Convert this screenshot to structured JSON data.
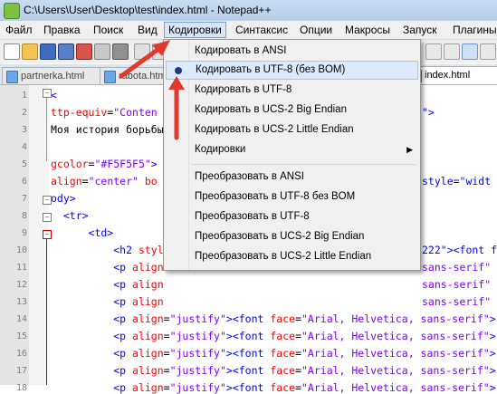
{
  "window": {
    "title": "C:\\Users\\User\\Desktop\\test\\index.html - Notepad++"
  },
  "menubar": {
    "items": [
      "Файл",
      "Правка",
      "Поиск",
      "Вид",
      "Кодировки",
      "Синтаксис",
      "Опции",
      "Макросы",
      "Запуск",
      "Плагины"
    ]
  },
  "tabs": [
    {
      "label": "partnerka.html"
    },
    {
      "label": "rabota.htm"
    },
    {
      "label": "index.html"
    }
  ],
  "editor": {
    "line_numbers": [
      "1",
      "2",
      "3",
      "4",
      "5",
      "6",
      "7",
      "8",
      "9",
      "10",
      "11",
      "12",
      "13",
      "14",
      "15",
      "16",
      "17",
      "18"
    ],
    "lines": [
      [
        {
          "c": "tag",
          "t": "<"
        }
      ],
      [
        {
          "c": "attr",
          "t": "ttp-equiv"
        },
        {
          "c": "txt",
          "t": "="
        },
        {
          "c": "val",
          "t": "\"Conten"
        }
      ],
      [
        {
          "c": "txt",
          "t": "Моя история борьбы"
        }
      ],
      [
        {
          "c": "txt",
          "t": ""
        }
      ],
      [
        {
          "c": "attr",
          "t": "gcolor"
        },
        {
          "c": "txt",
          "t": "="
        },
        {
          "c": "val",
          "t": "\"#F5F5F5\""
        },
        {
          "c": "tag",
          "t": ">"
        }
      ],
      [
        {
          "c": "attr",
          "t": "align"
        },
        {
          "c": "txt",
          "t": "="
        },
        {
          "c": "val",
          "t": "\"center\""
        },
        {
          "c": "attr",
          "t": " bo"
        }
      ],
      [
        {
          "c": "tag",
          "t": "ody>"
        }
      ],
      [
        {
          "c": "tag",
          "t": "  <tr>"
        }
      ],
      [
        {
          "c": "tag",
          "t": "      <td>"
        }
      ],
      [
        {
          "c": "tag",
          "t": "          <h2 "
        },
        {
          "c": "attr",
          "t": "styl"
        }
      ],
      [
        {
          "c": "tag",
          "t": "          <p "
        },
        {
          "c": "attr",
          "t": "align"
        }
      ],
      [
        {
          "c": "tag",
          "t": "          <p "
        },
        {
          "c": "attr",
          "t": "align"
        }
      ],
      [
        {
          "c": "tag",
          "t": "          <p "
        },
        {
          "c": "attr",
          "t": "align"
        }
      ],
      [
        {
          "c": "tag",
          "t": "          <p "
        },
        {
          "c": "attr",
          "t": "align"
        },
        {
          "c": "txt",
          "t": "="
        },
        {
          "c": "val",
          "t": "\"justify\""
        },
        {
          "c": "tag",
          "t": "><font "
        },
        {
          "c": "attr",
          "t": "face"
        },
        {
          "c": "txt",
          "t": "="
        },
        {
          "c": "val",
          "t": "\"Arial, Helvetica, sans-serif\""
        },
        {
          "c": "tag",
          "t": ">"
        }
      ],
      [
        {
          "c": "tag",
          "t": "          <p "
        },
        {
          "c": "attr",
          "t": "align"
        },
        {
          "c": "txt",
          "t": "="
        },
        {
          "c": "val",
          "t": "\"justify\""
        },
        {
          "c": "tag",
          "t": "><font "
        },
        {
          "c": "attr",
          "t": "face"
        },
        {
          "c": "txt",
          "t": "="
        },
        {
          "c": "val",
          "t": "\"Arial, Helvetica, sans-serif\""
        },
        {
          "c": "tag",
          "t": ">"
        }
      ],
      [
        {
          "c": "tag",
          "t": "          <p "
        },
        {
          "c": "attr",
          "t": "align"
        },
        {
          "c": "txt",
          "t": "="
        },
        {
          "c": "val",
          "t": "\"justify\""
        },
        {
          "c": "tag",
          "t": "><font "
        },
        {
          "c": "attr",
          "t": "face"
        },
        {
          "c": "txt",
          "t": "="
        },
        {
          "c": "val",
          "t": "\"Arial, Helvetica, sans-serif\""
        },
        {
          "c": "tag",
          "t": ">"
        }
      ],
      [
        {
          "c": "tag",
          "t": "          <p "
        },
        {
          "c": "attr",
          "t": "align"
        },
        {
          "c": "txt",
          "t": "="
        },
        {
          "c": "val",
          "t": "\"justify\""
        },
        {
          "c": "tag",
          "t": "><font "
        },
        {
          "c": "attr",
          "t": "face"
        },
        {
          "c": "txt",
          "t": "="
        },
        {
          "c": "val",
          "t": "\"Arial, Helvetica, sans-serif\""
        },
        {
          "c": "tag",
          "t": ">"
        }
      ],
      [
        {
          "c": "tag",
          "t": "          <p "
        },
        {
          "c": "attr",
          "t": "align"
        },
        {
          "c": "txt",
          "t": "="
        },
        {
          "c": "val",
          "t": "\"justify\""
        },
        {
          "c": "tag",
          "t": "><font "
        },
        {
          "c": "attr",
          "t": "face"
        },
        {
          "c": "txt",
          "t": "="
        },
        {
          "c": "val",
          "t": "\"Arial, Helvetica, sans-serif\""
        },
        {
          "c": "tag",
          "t": ">"
        }
      ]
    ],
    "right_fragments": [
      {
        "line": 2,
        "t": "\">"
      },
      {
        "line": 6,
        "t": "style=\"widt"
      },
      {
        "line": 10,
        "t": "222\"><font f"
      },
      {
        "line": 11,
        "t": "sans-serif\""
      },
      {
        "line": 12,
        "t": "sans-serif\""
      },
      {
        "line": 13,
        "t": "sans-serif\""
      }
    ]
  },
  "encoding_menu": {
    "items": [
      {
        "label": "Кодировать в ANSI",
        "checked": false,
        "highlighted": false,
        "submenu": false
      },
      {
        "label": "Кодировать в UTF-8 (без BOM)",
        "checked": true,
        "highlighted": true,
        "submenu": false
      },
      {
        "label": "Кодировать в UTF-8",
        "checked": false,
        "highlighted": false,
        "submenu": false
      },
      {
        "label": "Кодировать в UCS-2 Big Endian",
        "checked": false,
        "highlighted": false,
        "submenu": false
      },
      {
        "label": "Кодировать в UCS-2 Little Endian",
        "checked": false,
        "highlighted": false,
        "submenu": false
      },
      {
        "label": "Кодировки",
        "checked": false,
        "highlighted": false,
        "submenu": true
      },
      {
        "label": "Преобразовать в ANSI",
        "checked": false,
        "highlighted": false,
        "submenu": false
      },
      {
        "label": "Преобразовать в UTF-8 без BOM",
        "checked": false,
        "highlighted": false,
        "submenu": false
      },
      {
        "label": "Преобразовать в UTF-8",
        "checked": false,
        "highlighted": false,
        "submenu": false
      },
      {
        "label": "Преобразовать в UCS-2 Big Endian",
        "checked": false,
        "highlighted": false,
        "submenu": false
      },
      {
        "label": "Преобразовать в UCS-2 Little Endian",
        "checked": false,
        "highlighted": false,
        "submenu": false
      }
    ]
  },
  "colors": {
    "annotation_arrow": "#e03a2c",
    "menu_highlight": "#dce9f8"
  }
}
